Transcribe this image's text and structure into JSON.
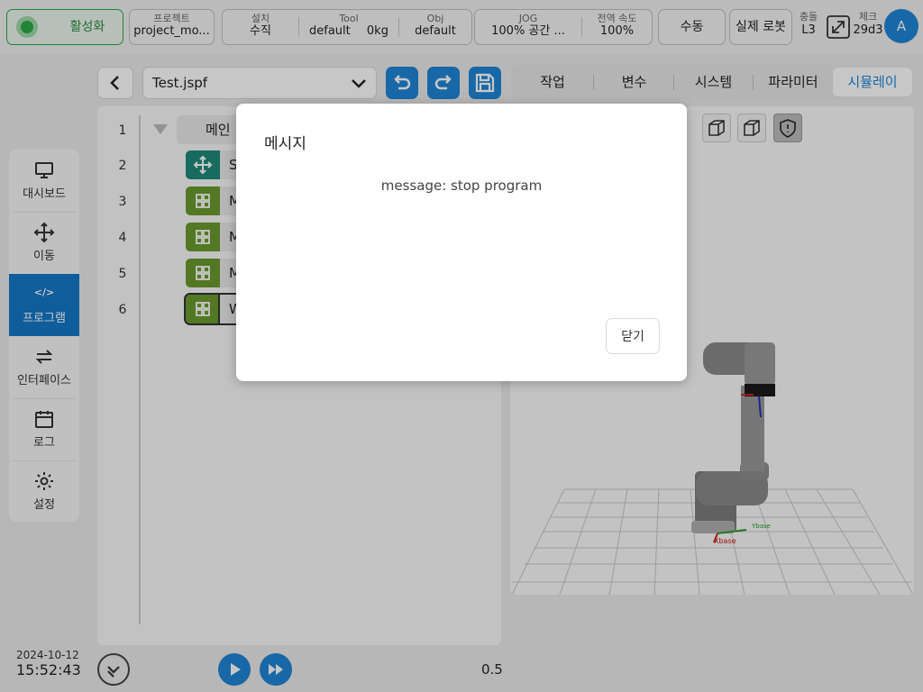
{
  "topbar": {
    "activate_label": "활성화",
    "project": {
      "caption": "프로젝트",
      "value": "project_mo..."
    },
    "install": {
      "caption": "설치",
      "value": "수직"
    },
    "tool": {
      "caption": "Tool",
      "value": "default",
      "extra": "0kg"
    },
    "obj": {
      "caption": "Obj",
      "value": "default"
    },
    "jog": {
      "caption": "JOG",
      "value": "100%  공간 ..."
    },
    "global_speed": {
      "caption": "전역 속도",
      "value": "100%"
    },
    "manual_label": "수동",
    "real_robot_label": "실제 로봇",
    "collision": {
      "caption": "충돌",
      "value": "L3"
    },
    "check": {
      "caption": "체크",
      "value": "29d3"
    },
    "avatar_letter": "A"
  },
  "sidenav": {
    "items": [
      {
        "label": "대시보드",
        "icon": "monitor-icon"
      },
      {
        "label": "이동",
        "icon": "move-icon"
      },
      {
        "label": "프로그램",
        "icon": "code-icon",
        "active": true
      },
      {
        "label": "인터페이스",
        "icon": "swap-icon"
      },
      {
        "label": "로그",
        "icon": "calendar-icon"
      },
      {
        "label": "설정",
        "icon": "gear-icon"
      }
    ],
    "code_glyph": "</>"
  },
  "program": {
    "file_name": "Test.jspf",
    "tabs": [
      {
        "label": "작업"
      },
      {
        "label": "변수"
      },
      {
        "label": "시스템"
      },
      {
        "label": "파라미터"
      },
      {
        "label": "시뮬레이",
        "active": true
      }
    ],
    "lines": [
      {
        "no": "1",
        "text": "메인"
      },
      {
        "no": "2",
        "text": "S"
      },
      {
        "no": "3",
        "text": "M"
      },
      {
        "no": "4",
        "text": "M"
      },
      {
        "no": "5",
        "text": "M"
      },
      {
        "no": "6",
        "text": "W"
      }
    ],
    "speed_value": "0.5"
  },
  "sim": {
    "x_axis_label": "Xbase",
    "y_axis_label": "Ybase"
  },
  "footer": {
    "date": "2024-10-12",
    "time": "15:52:43"
  },
  "dialog": {
    "title": "메시지",
    "message": "message: stop program",
    "close_label": "닫기"
  },
  "colors": {
    "accent_blue": "#1f86d6",
    "nav_active": "#1578c8",
    "move_node": "#1e8a7a",
    "block_node": "#6a9a2e",
    "activate_green": "#2ea84a"
  }
}
